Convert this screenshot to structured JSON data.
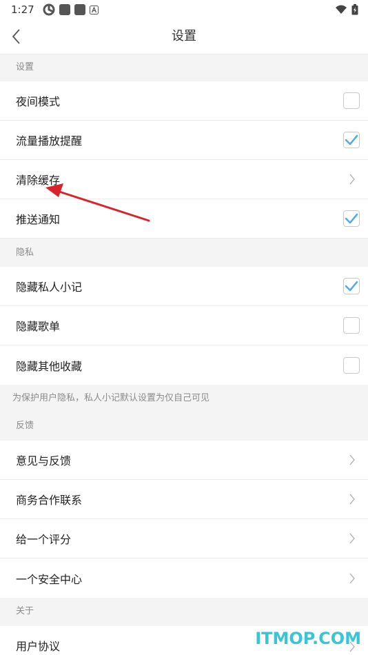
{
  "status_bar": {
    "time": "1:27",
    "icons": [
      "app-icon-1",
      "app-icon-2",
      "app-icon-3",
      "a-icon"
    ],
    "right_icons": [
      "wifi-icon",
      "battery-icon"
    ]
  },
  "navbar": {
    "title": "设置",
    "back_icon": "back-chevron-icon"
  },
  "sections": {
    "settings": {
      "header": "设置",
      "items": [
        {
          "label": "夜间模式",
          "control": "checkbox",
          "checked": false
        },
        {
          "label": "流量播放提醒",
          "control": "checkbox",
          "checked": true
        },
        {
          "label": "清除缓存",
          "control": "chevron"
        },
        {
          "label": "推送通知",
          "control": "checkbox",
          "checked": true
        }
      ]
    },
    "privacy": {
      "header": "隐私",
      "items": [
        {
          "label": "隐藏私人小记",
          "control": "checkbox",
          "checked": true
        },
        {
          "label": "隐藏歌单",
          "control": "checkbox",
          "checked": false
        },
        {
          "label": "隐藏其他收藏",
          "control": "checkbox",
          "checked": false
        }
      ],
      "note": "为保护用户隐私，私人小记默认设置为仅自己可见"
    },
    "feedback": {
      "header": "反馈",
      "items": [
        {
          "label": "意见与反馈",
          "control": "chevron"
        },
        {
          "label": "商务合作联系",
          "control": "chevron"
        },
        {
          "label": "给一个评分",
          "control": "chevron"
        },
        {
          "label": "一个安全中心",
          "control": "chevron"
        }
      ]
    },
    "about": {
      "header": "关于",
      "items": [
        {
          "label": "用户协议",
          "control": "chevron"
        }
      ]
    }
  },
  "colors": {
    "check": "#5aa9e6",
    "arrow": "#d9232a",
    "watermark": "#39c6d4"
  },
  "watermark": "ITMOP.COM"
}
